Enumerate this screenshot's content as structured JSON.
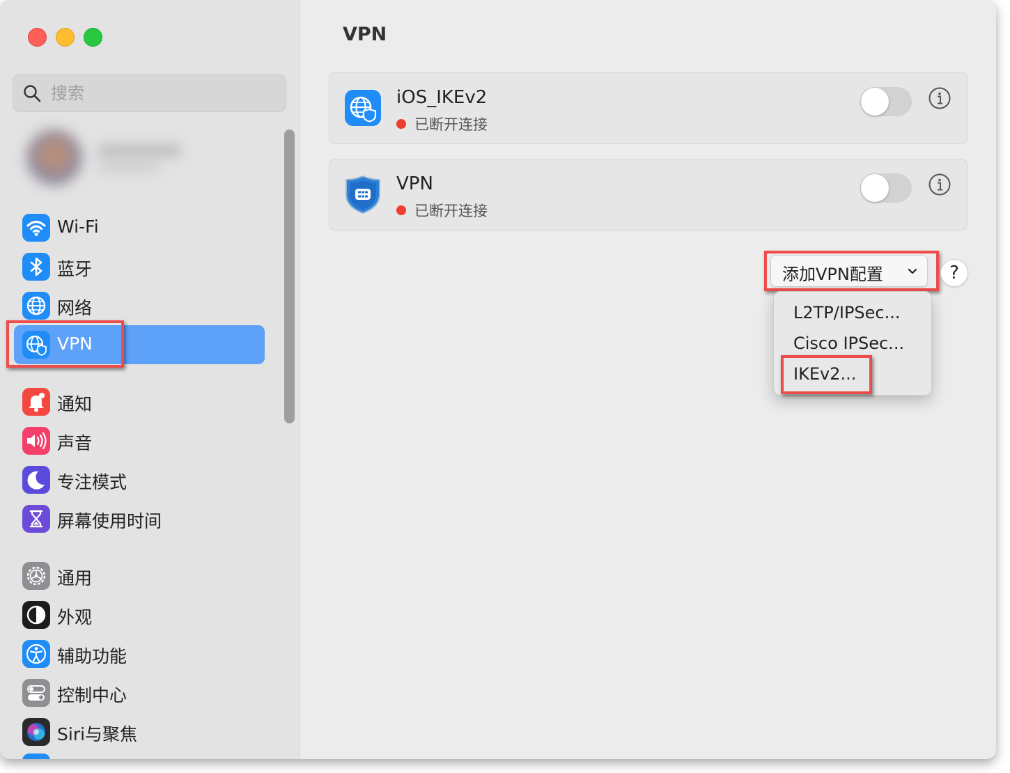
{
  "window": {
    "title": "VPN"
  },
  "sidebar": {
    "search_placeholder": "搜索",
    "items": [
      {
        "label": "Wi-Fi",
        "icon": "wifi-icon",
        "color": "#1f8cf7"
      },
      {
        "label": "蓝牙",
        "icon": "bluetooth-icon",
        "color": "#1f8cf7"
      },
      {
        "label": "网络",
        "icon": "network-globe-icon",
        "color": "#1f8cf7"
      },
      {
        "label": "VPN",
        "icon": "vpn-globe-shield-icon",
        "color": "#1f8cf7",
        "selected": true
      },
      {
        "label": "通知",
        "icon": "bell-icon",
        "color": "#f4473f"
      },
      {
        "label": "声音",
        "icon": "speaker-icon",
        "color": "#f43f6a"
      },
      {
        "label": "专注模式",
        "icon": "moon-icon",
        "color": "#5b4bdc"
      },
      {
        "label": "屏幕使用时间",
        "icon": "hourglass-icon",
        "color": "#6c4bd8"
      },
      {
        "label": "通用",
        "icon": "gear-icon",
        "color": "#8e8e93"
      },
      {
        "label": "外观",
        "icon": "appearance-icon",
        "color": "#1c1c1e"
      },
      {
        "label": "辅助功能",
        "icon": "accessibility-icon",
        "color": "#1f8cf7"
      },
      {
        "label": "控制中心",
        "icon": "control-center-icon",
        "color": "#8e8e93"
      },
      {
        "label": "Siri与聚焦",
        "icon": "siri-icon",
        "color": "#2a2a2a"
      }
    ]
  },
  "vpn_list": [
    {
      "name": "iOS_IKEv2",
      "status": "已断开连接",
      "enabled": false,
      "icon": "globe-shield-icon"
    },
    {
      "name": "VPN",
      "status": "已断开连接",
      "enabled": false,
      "icon": "shield-icon"
    }
  ],
  "add_button": {
    "label": "添加VPN配置"
  },
  "help_label": "?",
  "dropdown": {
    "items": [
      "L2TP/IPSec...",
      "Cisco IPSec...",
      "IKEv2..."
    ]
  },
  "colors": {
    "accent": "#5da1f9",
    "status_disconnected": "#f03c30",
    "annotation": "#ee4b4b"
  }
}
